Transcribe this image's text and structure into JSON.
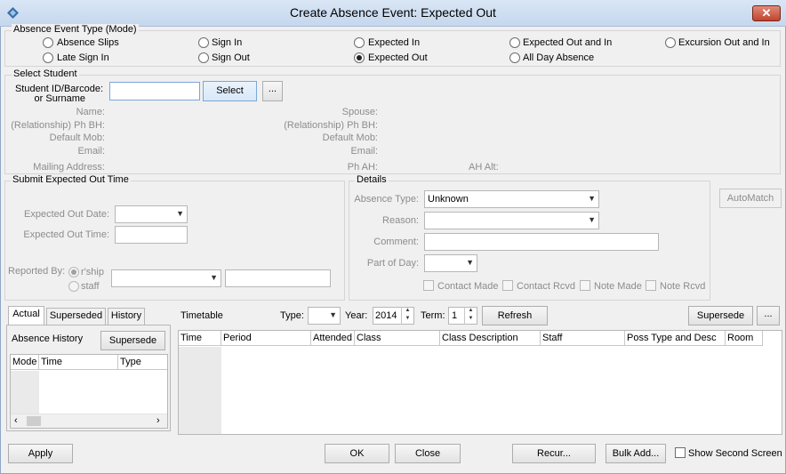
{
  "window": {
    "title": "Create Absence Event: Expected Out",
    "close_glyph": "✕"
  },
  "mode_group": {
    "label": "Absence Event Type (Mode)",
    "options": [
      {
        "label": "Absence Slips",
        "selected": false
      },
      {
        "label": "Sign In",
        "selected": false
      },
      {
        "label": "Expected In",
        "selected": false
      },
      {
        "label": "Expected Out and In",
        "selected": false
      },
      {
        "label": "Excursion Out and In",
        "selected": false
      },
      {
        "label": "Late Sign In",
        "selected": false
      },
      {
        "label": "Sign Out",
        "selected": false
      },
      {
        "label": "Expected Out",
        "selected": true
      },
      {
        "label": "All Day Absence",
        "selected": false
      }
    ]
  },
  "student_group": {
    "label": "Select Student",
    "id_label": "Student ID/Barcode:",
    "id_label_2": "or Surname",
    "id_value": "",
    "select_button": "Select",
    "more_button": "...",
    "fields_left": [
      "Name:",
      "(Relationship) Ph BH:",
      "Default Mob:",
      "Email:",
      "Mailing Address:"
    ],
    "fields_right": [
      "Spouse:",
      "(Relationship) Ph BH:",
      "Default Mob:",
      "Email:",
      "Ph AH:"
    ],
    "ah_alt_label": "AH Alt:"
  },
  "submit_group": {
    "label": "Submit Expected Out Time",
    "date_label": "Expected Out Date:",
    "time_label": "Expected Out Time:",
    "reported_by_label": "Reported By:",
    "rship_label": "r'ship",
    "staff_label": "staff"
  },
  "details_group": {
    "label": "Details",
    "absence_type_label": "Absence Type:",
    "absence_type_value": "Unknown",
    "reason_label": "Reason:",
    "comment_label": "Comment:",
    "part_of_day_label": "Part of Day:",
    "checkboxes": [
      "Contact Made",
      "Contact Rcvd",
      "Note Made",
      "Note Rcvd"
    ],
    "automatch_button": "AutoMatch"
  },
  "left_tabs": {
    "tabs": [
      "Actual",
      "Superseded",
      "History"
    ],
    "history_label": "Absence History",
    "supersede_button": "Supersede",
    "columns": [
      "Mode",
      "Time",
      "Type"
    ]
  },
  "timetable": {
    "label": "Timetable",
    "type_label": "Type:",
    "year_label": "Year:",
    "year_value": "2014",
    "term_label": "Term:",
    "term_value": "1",
    "refresh_button": "Refresh",
    "supersede_button": "Supersede",
    "more_button": "...",
    "columns": [
      "Time",
      "Period",
      "Attended",
      "Class",
      "Class Description",
      "Staff",
      "Poss Type and Desc",
      "Room"
    ]
  },
  "footer": {
    "apply_button": "Apply",
    "ok_button": "OK",
    "close_button": "Close",
    "recur_button": "Recur...",
    "bulk_add_button": "Bulk Add...",
    "show_second_screen_label": "Show Second Screen"
  },
  "colors": {
    "titlebar": "#c5d7ee",
    "close_button": "#c2442d",
    "body": "#f0f0f0"
  }
}
